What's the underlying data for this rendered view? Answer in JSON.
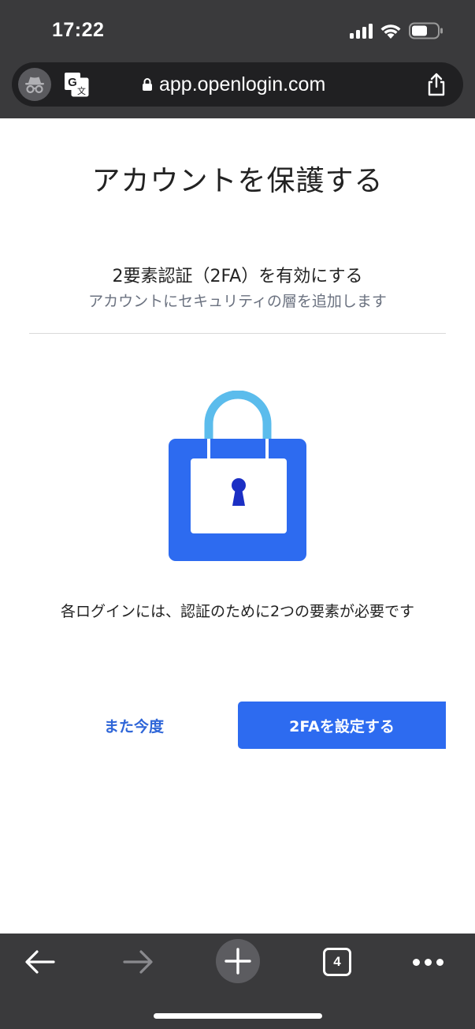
{
  "status_bar": {
    "time": "17:22",
    "icons": [
      "signal-icon",
      "wifi-icon",
      "battery-icon"
    ]
  },
  "browser": {
    "url": "app.openlogin.com",
    "icons": [
      "incognito-icon",
      "translate-icon",
      "lock-icon",
      "share-icon"
    ]
  },
  "page": {
    "title": "アカウントを保護する",
    "subtitle": "2要素認証（2FA）を有効にする",
    "description": "アカウントにセキュリティの層を追加します",
    "info": "各ログインには、認証のために2つの要素が必要です",
    "later_label": "また今度",
    "setup_label": "2FAを設定する"
  },
  "toolbar": {
    "tab_count": "4",
    "icons": [
      "back-arrow-icon",
      "forward-arrow-icon",
      "plus-icon",
      "more-icon"
    ]
  },
  "colors": {
    "chrome_bg": "#3a3a3c",
    "primary_blue": "#2d6bf0",
    "link_blue": "#2f66d8",
    "shackle_blue": "#5bbcec",
    "keyhole_blue": "#1b2fc4"
  }
}
